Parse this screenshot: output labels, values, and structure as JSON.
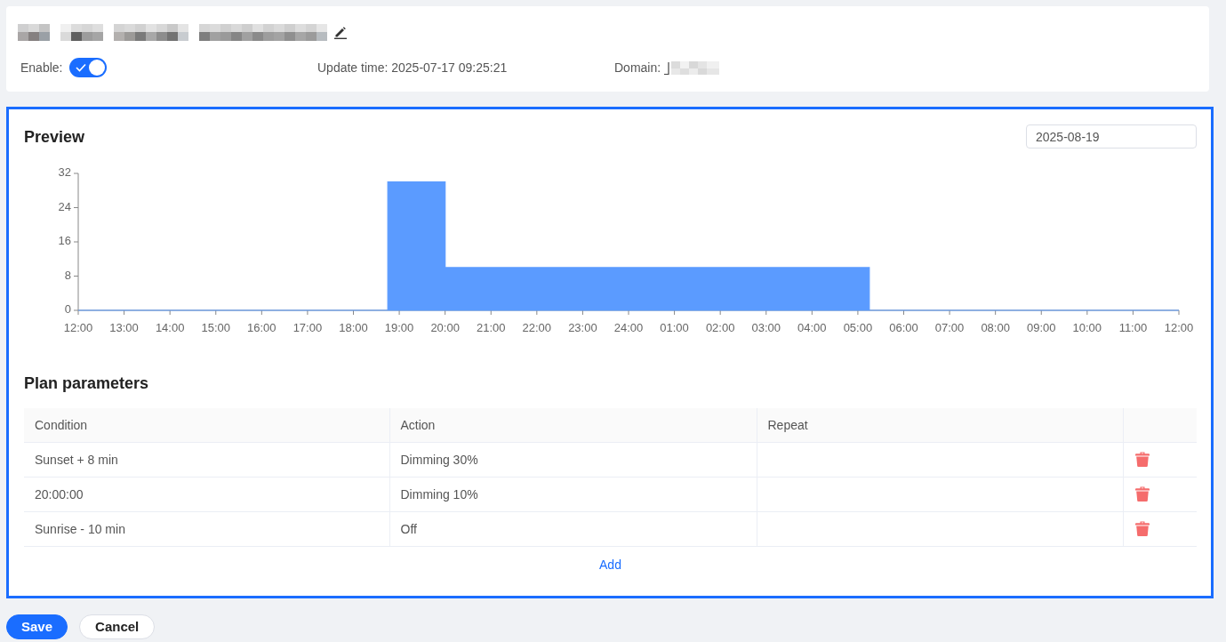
{
  "header": {
    "enable": {
      "label": "Enable:",
      "on": true
    },
    "update_time": "Update time: 2025-07-17 09:25:21",
    "domain_label": "Domain:"
  },
  "preview": {
    "title": "Preview",
    "date": "2025-08-19",
    "chart_data": {
      "type": "area",
      "categories": [
        "12:00",
        null,
        null,
        null,
        "13:00",
        null,
        null,
        null,
        "14:00",
        null,
        null,
        null,
        "15:00",
        null,
        null,
        null,
        "16:00",
        null,
        null,
        null,
        "17:00",
        null,
        null,
        null,
        "18:00",
        null,
        null,
        null,
        "19:00",
        null,
        null,
        null,
        "20:00",
        null,
        null,
        null,
        "21:00",
        null,
        null,
        null,
        "22:00",
        null,
        null,
        null,
        "23:00",
        null,
        null,
        null,
        "24:00",
        null,
        null,
        null,
        "01:00",
        null,
        null,
        null,
        "02:00",
        null,
        null,
        null,
        "03:00",
        null,
        null,
        null,
        "04:00",
        null,
        null,
        null,
        "05:00",
        null,
        null,
        null,
        "06:00",
        null,
        null,
        null,
        "07:00",
        null,
        null,
        null,
        "08:00",
        null,
        null,
        null,
        "09:00",
        null,
        null,
        null,
        "10:00",
        null,
        null,
        null,
        "11:00",
        null,
        null,
        null,
        "12:00"
      ],
      "series": [
        {
          "color": "#5b9bff",
          "values": [
            0,
            0,
            0,
            0,
            0,
            0,
            0,
            0,
            0,
            0,
            0,
            0,
            0,
            0,
            0,
            0,
            0,
            0,
            0,
            0,
            0,
            0,
            0,
            0,
            0,
            0,
            0,
            30,
            30,
            30,
            30,
            30,
            10,
            10,
            10,
            10,
            10,
            10,
            10,
            10,
            10,
            10,
            10,
            10,
            10,
            10,
            10,
            10,
            10,
            10,
            10,
            10,
            10,
            10,
            10,
            10,
            10,
            10,
            10,
            10,
            10,
            10,
            10,
            10,
            10,
            10,
            10,
            10,
            10,
            0,
            0,
            0,
            0,
            0,
            0,
            0,
            0,
            0,
            0,
            0,
            0,
            0,
            0,
            0,
            0,
            0,
            0,
            0,
            0,
            0,
            0,
            0,
            0,
            0,
            0,
            0,
            0
          ]
        }
      ],
      "ylim": [
        0,
        32
      ],
      "yticks": [
        0,
        8,
        16,
        24,
        32
      ]
    }
  },
  "plan": {
    "title": "Plan parameters",
    "columns": [
      "Condition",
      "Action",
      "Repeat"
    ],
    "rows": [
      {
        "condition": "Sunset + 8 min",
        "action": "Dimming 30%"
      },
      {
        "condition": "20:00:00",
        "action": "Dimming 10%"
      },
      {
        "condition": "Sunrise - 10 min",
        "action": "Off"
      }
    ],
    "add_link": "Add"
  },
  "buttons": [
    {
      "label": "Save",
      "kind": "primary"
    },
    {
      "label": "Cancel",
      "kind": "default"
    }
  ]
}
